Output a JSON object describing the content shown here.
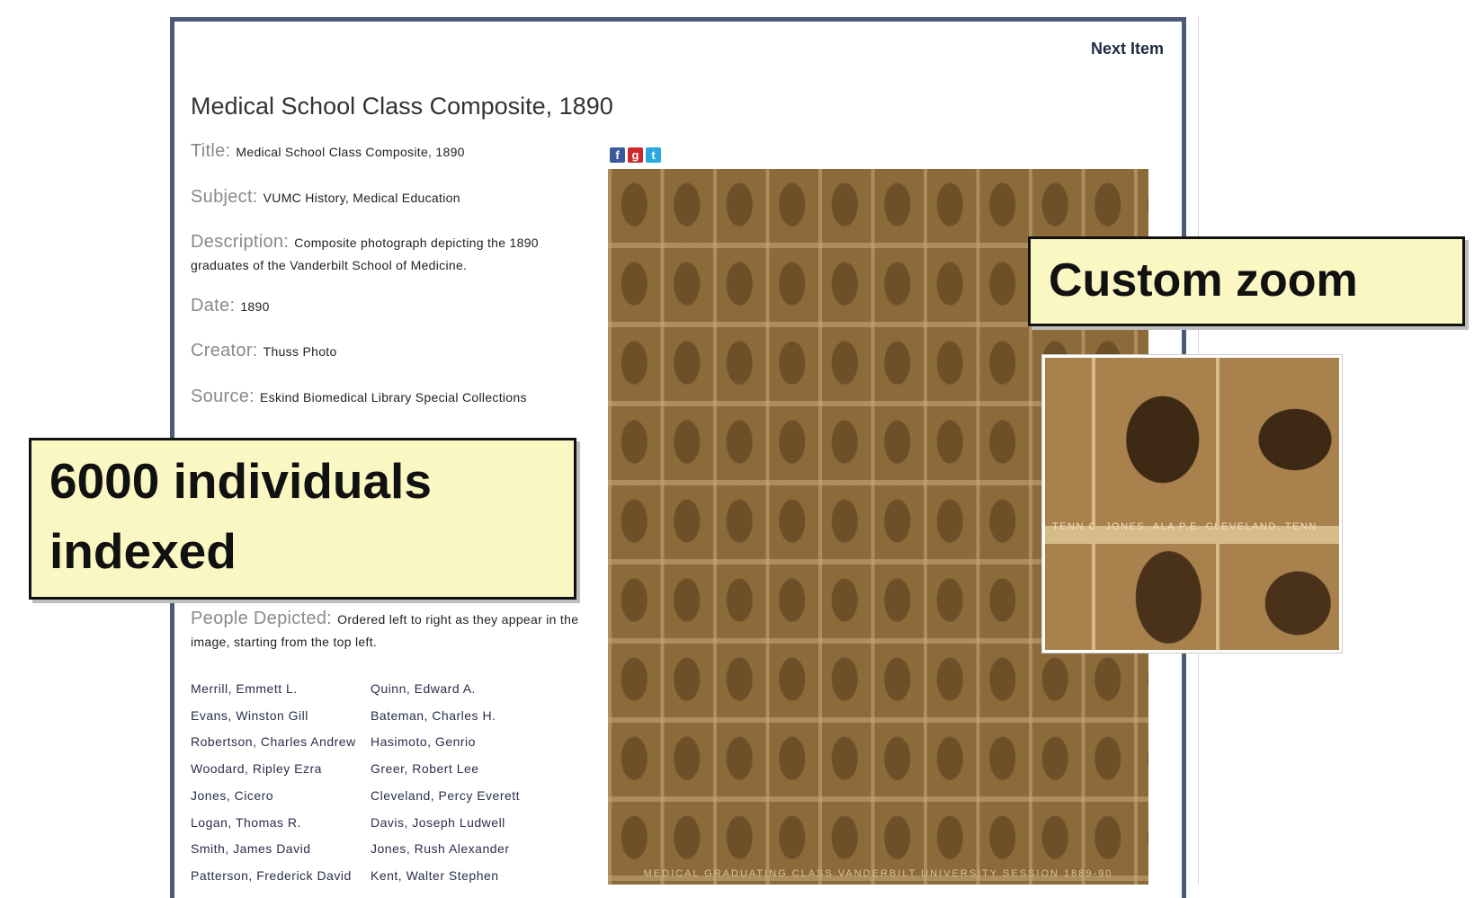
{
  "nav": {
    "next_item": "Next Item"
  },
  "page_title": "Medical School Class Composite, 1890",
  "fields": {
    "title": {
      "label": "Title:",
      "value": "Medical School Class Composite, 1890"
    },
    "subject": {
      "label": "Subject:",
      "value": "VUMC History, Medical Education"
    },
    "description": {
      "label": "Description:",
      "value": "Composite photograph depicting the 1890 graduates of the Vanderbilt School of Medicine."
    },
    "date": {
      "label": "Date:",
      "value": "1890"
    },
    "creator": {
      "label": "Creator:",
      "value": "Thuss Photo"
    },
    "source": {
      "label": "Source:",
      "value": "Eskind Biomedical Library Special Collections"
    },
    "people": {
      "label": "People Depicted:",
      "value": "Ordered left to right as they appear in the image, starting from the top left."
    }
  },
  "people_depicted": [
    [
      "Merrill, Emmett L.",
      "Quinn, Edward A."
    ],
    [
      "Evans, Winston Gill",
      "Bateman, Charles H."
    ],
    [
      "Robertson, Charles Andrew",
      "Hasimoto, Genrio"
    ],
    [
      "Woodard, Ripley Ezra",
      "Greer, Robert Lee"
    ],
    [
      "Jones, Cicero",
      "Cleveland, Percy Everett"
    ],
    [
      "Logan, Thomas R.",
      "Davis, Joseph Ludwell"
    ],
    [
      "Smith, James David",
      "Jones, Rush Alexander"
    ],
    [
      "Patterson, Frederick David",
      "Kent, Walter Stephen"
    ]
  ],
  "social": {
    "facebook": "f",
    "google": "g",
    "twitter": "t"
  },
  "photo_caption": "MEDICAL GRADUATING CLASS VANDERBILT UNIVERSITY SESSION 1889-90",
  "zoom_caption": "TENN   C. JONES, ALA   P.E. CLEVELAND, TENN",
  "callouts": {
    "zoom": "Custom zoom",
    "indexed": "6000 individuals indexed"
  }
}
